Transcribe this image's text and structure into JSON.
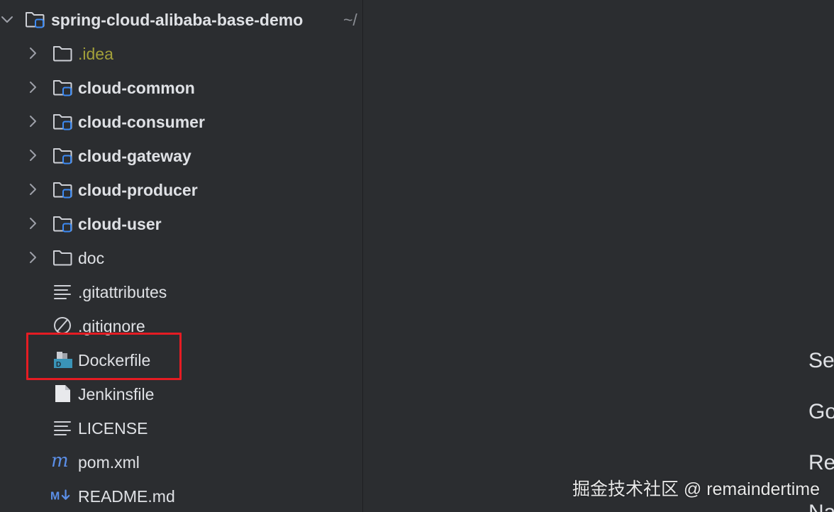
{
  "project_tree": {
    "root": {
      "label": "spring-cloud-alibaba-base-demo",
      "suffix": "~/"
    },
    "items": [
      {
        "label": ".idea",
        "type": "folder-excluded",
        "expandable": true
      },
      {
        "label": "cloud-common",
        "type": "module",
        "expandable": true
      },
      {
        "label": "cloud-consumer",
        "type": "module",
        "expandable": true
      },
      {
        "label": "cloud-gateway",
        "type": "module",
        "expandable": true
      },
      {
        "label": "cloud-producer",
        "type": "module",
        "expandable": true
      },
      {
        "label": "cloud-user",
        "type": "module",
        "expandable": true
      },
      {
        "label": "doc",
        "type": "folder",
        "expandable": true
      },
      {
        "label": ".gitattributes",
        "type": "text-file",
        "expandable": false
      },
      {
        "label": ".gitignore",
        "type": "ignore-file",
        "expandable": false
      },
      {
        "label": "Dockerfile",
        "type": "docker-file",
        "expandable": false,
        "highlighted": true
      },
      {
        "label": "Jenkinsfile",
        "type": "file",
        "expandable": false
      },
      {
        "label": "LICENSE",
        "type": "text-file",
        "expandable": false
      },
      {
        "label": "pom.xml",
        "type": "maven-file",
        "expandable": false
      },
      {
        "label": "README.md",
        "type": "markdown-file",
        "expandable": false
      }
    ]
  },
  "right_panel": {
    "partial_texts": [
      "Se",
      "Go",
      "Re",
      "Na"
    ]
  },
  "watermark": "掘金技术社区 @ remaindertime",
  "colors": {
    "background": "#2b2d30",
    "text": "#dfe1e5",
    "excluded_text": "#a3a03a",
    "highlight_border": "#e51c23",
    "module_badge": "#3d8bf5",
    "docker_icon": "#3a94b8"
  }
}
